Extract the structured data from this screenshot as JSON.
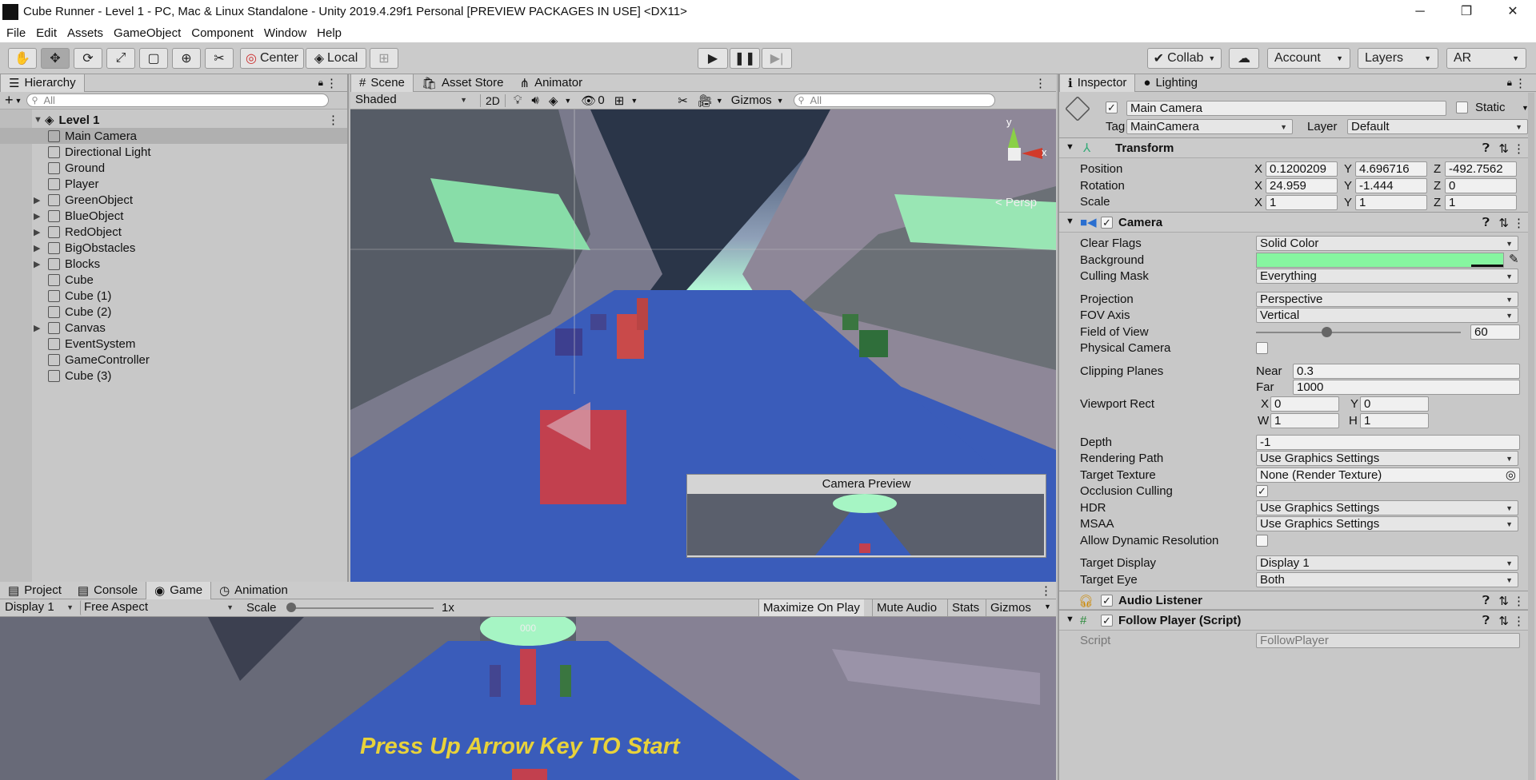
{
  "window": {
    "title": "Cube Runner - Level 1 - PC, Mac & Linux Standalone - Unity 2019.4.29f1 Personal [PREVIEW PACKAGES IN USE] <DX11>",
    "minimize": "─",
    "restore": "❐",
    "close": "✕"
  },
  "menu": [
    "File",
    "Edit",
    "Assets",
    "GameObject",
    "Component",
    "Window",
    "Help"
  ],
  "toolbar": {
    "pivot": "Center",
    "space": "Local",
    "collab": "Collab",
    "account": "Account",
    "layers": "Layers",
    "layout": "AR"
  },
  "hierarchy": {
    "tab": "Hierarchy",
    "search_placeholder": "All",
    "scene": "Level 1",
    "items": [
      {
        "name": "Main Camera",
        "expand": false
      },
      {
        "name": "Directional Light",
        "expand": false
      },
      {
        "name": "Ground",
        "expand": false
      },
      {
        "name": "Player",
        "expand": false
      },
      {
        "name": "GreenObject",
        "expand": true
      },
      {
        "name": "BlueObject",
        "expand": true
      },
      {
        "name": "RedObject",
        "expand": true
      },
      {
        "name": "BigObstacles",
        "expand": true
      },
      {
        "name": "Blocks",
        "expand": true
      },
      {
        "name": "Cube",
        "expand": false
      },
      {
        "name": "Cube (1)",
        "expand": false
      },
      {
        "name": "Cube (2)",
        "expand": false
      },
      {
        "name": "Canvas",
        "expand": true
      },
      {
        "name": "EventSystem",
        "expand": false
      },
      {
        "name": "GameController",
        "expand": false
      },
      {
        "name": "Cube (3)",
        "expand": false
      }
    ]
  },
  "scene": {
    "tabs": [
      "Scene",
      "Asset Store",
      "Animator"
    ],
    "shading": "Shaded",
    "mode2d": "2D",
    "hidden_count": "0",
    "gizmos": "Gizmos",
    "search_placeholder": "All",
    "persp": "< Persp",
    "axis_y": "y",
    "axis_x": "x",
    "camera_preview_title": "Camera Preview"
  },
  "game": {
    "tabs": [
      "Project",
      "Console",
      "Game",
      "Animation"
    ],
    "display": "Display 1",
    "aspect": "Free Aspect",
    "scale_label": "Scale",
    "scale_value": "1x",
    "maximize": "Maximize On Play",
    "mute": "Mute Audio",
    "stats": "Stats",
    "gizmos": "Gizmos",
    "score": "000",
    "prompt": "Press Up Arrow Key TO Start"
  },
  "inspector": {
    "tabs": [
      "Inspector",
      "Lighting"
    ],
    "object_name": "Main Camera",
    "static": "Static",
    "tag_label": "Tag",
    "tag": "MainCamera",
    "layer_label": "Layer",
    "layer": "Default",
    "transform": {
      "title": "Transform",
      "position_label": "Position",
      "rotation_label": "Rotation",
      "scale_label": "Scale",
      "x": "X",
      "y": "Y",
      "z": "Z",
      "position": [
        "0.1200209",
        "4.696716",
        "-492.7562"
      ],
      "rotation": [
        "24.959",
        "-1.444",
        "0"
      ],
      "scale": [
        "1",
        "1",
        "1"
      ]
    },
    "camera": {
      "title": "Camera",
      "clear_flags_label": "Clear Flags",
      "clear_flags": "Solid Color",
      "background_label": "Background",
      "background_color": "#86f5a0",
      "culling_mask_label": "Culling Mask",
      "culling_mask": "Everything",
      "projection_label": "Projection",
      "projection": "Perspective",
      "fov_axis_label": "FOV Axis",
      "fov_axis": "Vertical",
      "fov_label": "Field of View",
      "fov": "60",
      "physical_label": "Physical Camera",
      "clipping_label": "Clipping Planes",
      "near_label": "Near",
      "near": "0.3",
      "far_label": "Far",
      "far": "1000",
      "viewport_label": "Viewport Rect",
      "vx_label": "X",
      "vx": "0",
      "vy_label": "Y",
      "vy": "0",
      "vw_label": "W",
      "vw": "1",
      "vh_label": "H",
      "vh": "1",
      "depth_label": "Depth",
      "depth": "-1",
      "rendering_path_label": "Rendering Path",
      "rendering_path": "Use Graphics Settings",
      "target_texture_label": "Target Texture",
      "target_texture": "None (Render Texture)",
      "occlusion_label": "Occlusion Culling",
      "hdr_label": "HDR",
      "hdr": "Use Graphics Settings",
      "msaa_label": "MSAA",
      "msaa": "Use Graphics Settings",
      "dynres_label": "Allow Dynamic Resolution",
      "target_display_label": "Target Display",
      "target_display": "Display 1",
      "target_eye_label": "Target Eye",
      "target_eye": "Both"
    },
    "audio_listener": "Audio Listener",
    "follow": {
      "title": "Follow Player (Script)",
      "script_label": "Script",
      "script": "FollowPlayer"
    }
  }
}
